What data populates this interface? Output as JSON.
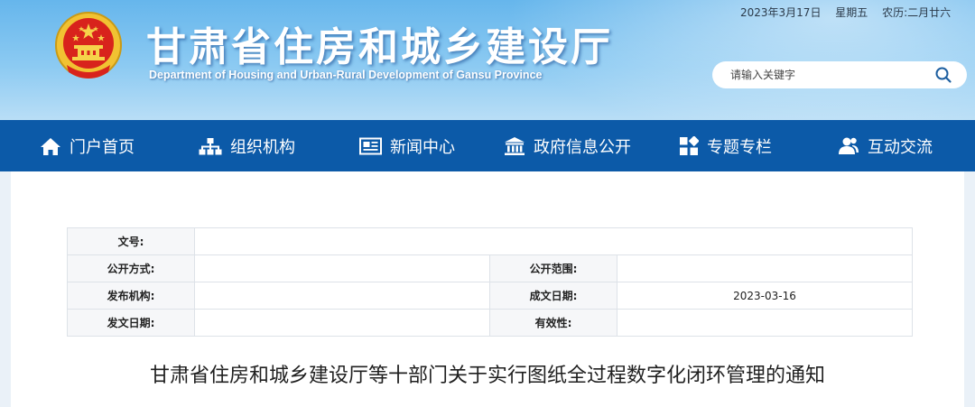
{
  "header": {
    "title": "甘肃省住房和城乡建设厅",
    "subtitle": "Department of Housing and Urban-Rural Development of Gansu Province",
    "date": "2023年3月17日",
    "weekday": "星期五",
    "lunar": "农历:二月廿六",
    "emblem_icon": "national-emblem",
    "search": {
      "placeholder": "请输入关键字",
      "icon": "search-icon"
    }
  },
  "nav": {
    "items": [
      {
        "label": "门户首页",
        "icon": "home-icon"
      },
      {
        "label": "组织机构",
        "icon": "org-chart-icon"
      },
      {
        "label": "新闻中心",
        "icon": "news-icon"
      },
      {
        "label": "政府信息公开",
        "icon": "government-building-icon"
      },
      {
        "label": "专题专栏",
        "icon": "grid-icon"
      },
      {
        "label": "互动交流",
        "icon": "users-icon"
      }
    ]
  },
  "meta_table": {
    "doc_number_label": "文号:",
    "doc_number_value": "",
    "disclosure_method_label": "公开方式:",
    "disclosure_method_value": "",
    "disclosure_scope_label": "公开范围:",
    "disclosure_scope_value": "",
    "issuer_label": "发布机构:",
    "issuer_value": "",
    "written_date_label": "成文日期:",
    "written_date_value": "2023-03-16",
    "issue_date_label": "发文日期:",
    "issue_date_value": "",
    "validity_label": "有效性:",
    "validity_value": ""
  },
  "document": {
    "title": "甘肃省住房和城乡建设厅等十部门关于实行图纸全过程数字化闭环管理的通知"
  },
  "colors": {
    "nav_bg": "#0c5aa8",
    "header_top": "#66b6ec",
    "emblem_red": "#d8231c",
    "emblem_gold": "#f1c232"
  }
}
